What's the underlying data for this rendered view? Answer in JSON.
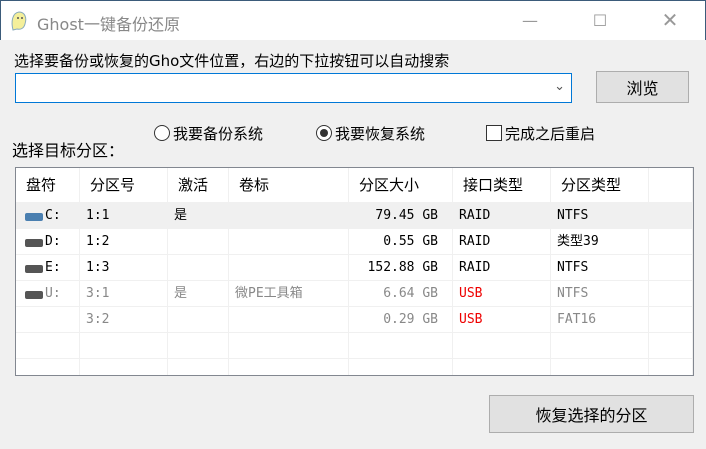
{
  "window": {
    "title": "Ghost一键备份还原",
    "minimize": "—",
    "maximize": "☐",
    "close": "✕"
  },
  "file": {
    "label": "选择要备份或恢复的Gho文件位置，右边的下拉按钮可以自动搜索",
    "value": "",
    "browse": "浏览"
  },
  "options": {
    "backup": "我要备份系统",
    "restore": "我要恢复系统",
    "restart": "完成之后重启",
    "target_label": "选择目标分区："
  },
  "table": {
    "headers": [
      "盘符",
      "分区号",
      "激活",
      "卷标",
      "分区大小",
      "接口类型",
      "分区类型"
    ],
    "rows": [
      {
        "drive": "C:",
        "part": "1:1",
        "active": "是",
        "label": "",
        "size": "79.45 GB",
        "iface": "RAID",
        "type": "NTFS"
      },
      {
        "drive": "D:",
        "part": "1:2",
        "active": "",
        "label": "",
        "size": "0.55 GB",
        "iface": "RAID",
        "type": "类型39"
      },
      {
        "drive": "E:",
        "part": "1:3",
        "active": "",
        "label": "",
        "size": "152.88 GB",
        "iface": "RAID",
        "type": "NTFS"
      },
      {
        "drive": "U:",
        "part": "3:1",
        "active": "是",
        "label": "微PE工具箱",
        "size": "6.64 GB",
        "iface": "USB",
        "type": "NTFS"
      },
      {
        "drive": "",
        "part": "3:2",
        "active": "",
        "label": "",
        "size": "0.29 GB",
        "iface": "USB",
        "type": "FAT16"
      }
    ]
  },
  "restore_button": "恢复选择的分区"
}
